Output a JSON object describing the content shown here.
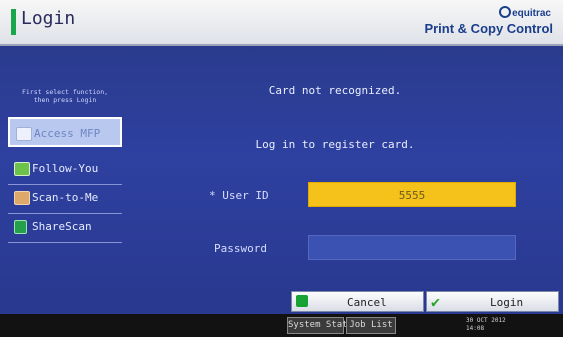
{
  "header": {
    "title": "Login",
    "brand_logo": "equitrac",
    "brand_tagline": "Print & Copy Control"
  },
  "sidebar": {
    "hint_line1": "First select function,",
    "hint_line2": "then press Login",
    "items": [
      {
        "label": "Access MFP",
        "icon": "copier-icon",
        "selected": true
      },
      {
        "label": "Follow-You",
        "icon": "follow-you-icon",
        "selected": false
      },
      {
        "label": "Scan-to-Me",
        "icon": "scan-to-me-icon",
        "selected": false
      },
      {
        "label": "ShareScan",
        "icon": "sharescan-icon",
        "selected": false
      }
    ]
  },
  "main": {
    "message": "Card not recognized.",
    "instruction": "Log in to register card.",
    "user_id_label": "* User ID",
    "user_id_value": "5555",
    "password_label": "Password",
    "password_value": ""
  },
  "footer": {
    "cancel_label": "Cancel",
    "login_label": "Login"
  },
  "statusbar": {
    "system_status_label": "System Status",
    "job_list_label": "Job List",
    "date": "30 OCT  2012",
    "time": "14:08"
  },
  "colors": {
    "background": "#2e40a0",
    "user_id_field": "#f5c21b",
    "accent_green": "#1aa64a",
    "brand": "#1a3d8c"
  }
}
